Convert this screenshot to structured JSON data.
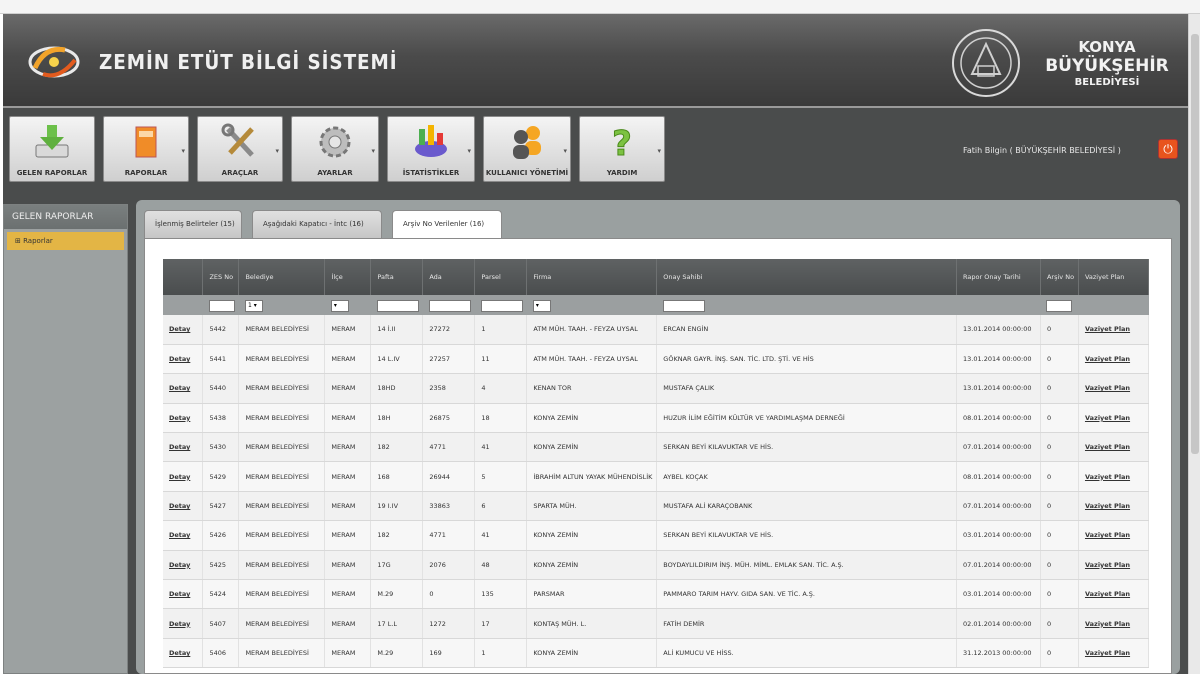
{
  "header": {
    "app_title": "ZEMİN ETÜT BİLGİ SİSTEMİ",
    "org_line1": "KONYA",
    "org_line2": "BÜYÜKŞEHİR",
    "org_line3": "BELEDİYESİ",
    "logo_icon": "app-logo-icon",
    "seal_icon": "municipality-seal-icon"
  },
  "toolbar": {
    "buttons": [
      {
        "label": "GELEN RAPORLAR",
        "icon": "download-tray-icon"
      },
      {
        "label": "RAPORLAR",
        "icon": "report-document-icon"
      },
      {
        "label": "ARAÇLAR",
        "icon": "tools-icon"
      },
      {
        "label": "AYARLAR",
        "icon": "gear-icon"
      },
      {
        "label": "İSTATİSTİKLER",
        "icon": "pie-chart-icon"
      },
      {
        "label": "KULLANICI YÖNETİMİ",
        "icon": "users-icon"
      },
      {
        "label": "YARDIM",
        "icon": "help-question-icon"
      }
    ],
    "user_text": "Fatih Bilgin ( BÜYÜKŞEHİR BELEDİYESİ )",
    "logout_icon": "power-icon"
  },
  "sidebar": {
    "title": "GELEN RAPORLAR",
    "items": [
      {
        "label": "Raporlar"
      }
    ]
  },
  "tabs": [
    {
      "label": "İşlenmiş Belirteler (15)"
    },
    {
      "label": "Aşağıdaki Kapatıcı - İntc (16)"
    },
    {
      "label": "Arşiv No Verilenler (16)"
    }
  ],
  "grid": {
    "headers": [
      "",
      "ZES No",
      "Belediye",
      "İlçe",
      "Pafta",
      "Ada",
      "Parsel",
      "Firma",
      "Onay Sahibi",
      "Rapor Onay Tarihi",
      "Arşiv No",
      "Vaziyet Plan"
    ],
    "filter_selects": [
      "1",
      "",
      ""
    ],
    "rows": [
      [
        "Detay",
        "5442",
        "MERAM BELEDİYESİ",
        "MERAM",
        "14 İ.II",
        "27272",
        "1",
        "ATM MÜH. TAAH. - FEYZA UYSAL",
        "ERCAN ENGİN",
        "13.01.2014 00:00:00",
        "0",
        "Vaziyet Plan"
      ],
      [
        "Detay",
        "5441",
        "MERAM BELEDİYESİ",
        "MERAM",
        "14 L.IV",
        "27257",
        "11",
        "ATM MÜH. TAAH. - FEYZA UYSAL",
        "GÖKNAR GAYR. İNŞ. SAN. TİC. LTD. ŞTİ. VE HİS",
        "13.01.2014 00:00:00",
        "0",
        "Vaziyet Plan"
      ],
      [
        "Detay",
        "5440",
        "MERAM BELEDİYESİ",
        "MERAM",
        "18HD",
        "2358",
        "4",
        "KENAN TOR",
        "MUSTAFA ÇALIK",
        "13.01.2014 00:00:00",
        "0",
        "Vaziyet Plan"
      ],
      [
        "Detay",
        "5438",
        "MERAM BELEDİYESİ",
        "MERAM",
        "18H",
        "26875",
        "18",
        "KONYA ZEMİN",
        "HUZUR İLİM EĞİTİM KÜLTÜR VE YARDIMLAŞMA DERNEĞİ",
        "08.01.2014 00:00:00",
        "0",
        "Vaziyet Plan"
      ],
      [
        "Detay",
        "5430",
        "MERAM BELEDİYESİ",
        "MERAM",
        "182",
        "4771",
        "41",
        "KONYA ZEMİN",
        "SERKAN BEYİ KILAVUKTAR VE HİS.",
        "07.01.2014 00:00:00",
        "0",
        "Vaziyet Plan"
      ],
      [
        "Detay",
        "5429",
        "MERAM BELEDİYESİ",
        "MERAM",
        "168",
        "26944",
        "5",
        "İBRAHİM ALTUN YAYAK MÜHENDİSLİK",
        "AYBEL KOÇAK",
        "08.01.2014 00:00:00",
        "0",
        "Vaziyet Plan"
      ],
      [
        "Detay",
        "5427",
        "MERAM BELEDİYESİ",
        "MERAM",
        "19 I.IV",
        "33863",
        "6",
        "SPARTA MÜH.",
        "MUSTAFA ALİ KARAÇOBANK",
        "07.01.2014 00:00:00",
        "0",
        "Vaziyet Plan"
      ],
      [
        "Detay",
        "5426",
        "MERAM BELEDİYESİ",
        "MERAM",
        "182",
        "4771",
        "41",
        "KONYA ZEMİN",
        "SERKAN BEYİ KILAVUKTAR VE HİS.",
        "03.01.2014 00:00:00",
        "0",
        "Vaziyet Plan"
      ],
      [
        "Detay",
        "5425",
        "MERAM BELEDİYESİ",
        "MERAM",
        "17G",
        "2076",
        "48",
        "KONYA ZEMİN",
        "BOYDAYLILDIRIM İNŞ. MÜH. MİML. EMLAK SAN. TİC. A.Ş.",
        "07.01.2014 00:00:00",
        "0",
        "Vaziyet Plan"
      ],
      [
        "Detay",
        "5424",
        "MERAM BELEDİYESİ",
        "MERAM",
        "M.29",
        "0",
        "135",
        "PARSMAR",
        "PAMMARO TARIM HAYV. GIDA SAN. VE TİC. A.Ş.",
        "03.01.2014 00:00:00",
        "0",
        "Vaziyet Plan"
      ],
      [
        "Detay",
        "5407",
        "MERAM BELEDİYESİ",
        "MERAM",
        "17 L.L",
        "1272",
        "17",
        "KONTAŞ MÜH. L.",
        "FATİH DEMİR",
        "02.01.2014 00:00:00",
        "0",
        "Vaziyet Plan"
      ],
      [
        "Detay",
        "5406",
        "MERAM BELEDİYESİ",
        "MERAM",
        "M.29",
        "169",
        "1",
        "KONYA ZEMİN",
        "ALİ KUMUCU VE HİSS.",
        "31.12.2013 00:00:00",
        "0",
        "Vaziyet Plan"
      ]
    ]
  }
}
